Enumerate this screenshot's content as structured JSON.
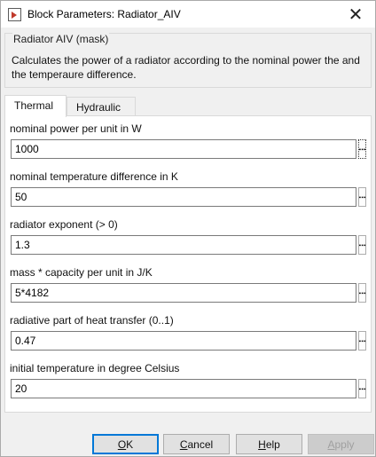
{
  "window": {
    "title": "Block Parameters: Radiator_AIV",
    "close_glyph": "✕"
  },
  "mask": {
    "title": "Radiator AIV (mask)",
    "description": "Calculates the power of a radiator according to the nominal power the and the temperaure difference."
  },
  "tabs": [
    {
      "label": "Thermal",
      "active": true
    },
    {
      "label": "Hydraulic",
      "active": false
    }
  ],
  "fields": [
    {
      "label": "nominal power per unit in W",
      "value": "1000"
    },
    {
      "label": "nominal temperature difference in K",
      "value": "50"
    },
    {
      "label": "radiator exponent (> 0)",
      "value": "1.3"
    },
    {
      "label": "mass * capacity per unit in J/K",
      "value": "5*4182"
    },
    {
      "label": "radiative part of heat transfer (0..1)",
      "value": "0.47"
    },
    {
      "label": "initial temperature in degree Celsius",
      "value": "20"
    }
  ],
  "buttons": {
    "ok": {
      "pre": "",
      "key": "O",
      "post": "K"
    },
    "cancel": {
      "pre": "",
      "key": "C",
      "post": "ancel"
    },
    "help": {
      "pre": "",
      "key": "H",
      "post": "elp"
    },
    "apply": {
      "pre": "",
      "key": "A",
      "post": "pply"
    }
  },
  "colors": {
    "accent": "#0078d7",
    "dialog_bg": "#f0f0f0",
    "panel_bg": "#ffffff"
  },
  "icons": {
    "app": "simulink-block-icon",
    "close": "close-icon",
    "more": "vertical-ellipsis-icon"
  }
}
